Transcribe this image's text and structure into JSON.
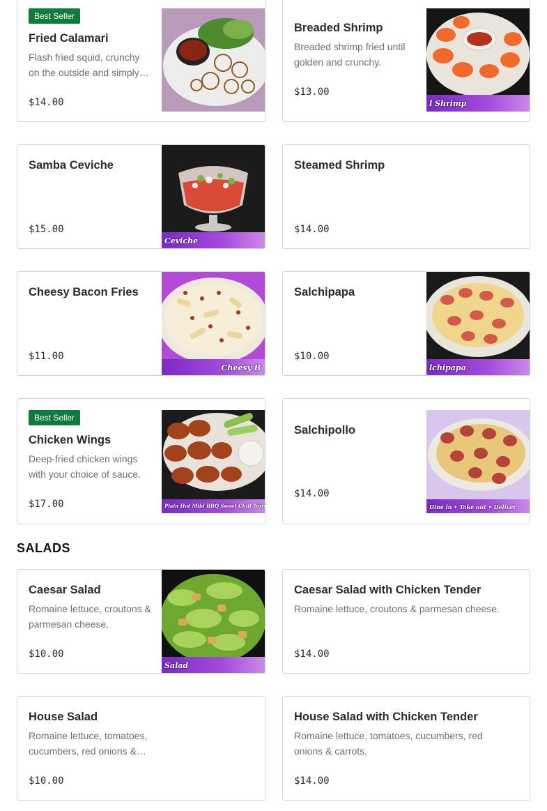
{
  "best_seller_label": "Best Seller",
  "sections": {
    "salads_title": "SALADS"
  },
  "items": [
    {
      "name": "Fried Calamari",
      "description": "Flash fried squid, crunchy on the outside and simply tender on the inside.",
      "price": "$14.00",
      "badge": "Best Seller",
      "image": "calamari-photo"
    },
    {
      "name": "Breaded Shrimp",
      "description": "Breaded shrimp fried until golden and crunchy.",
      "price": "$13.00",
      "image": "shrimp-photo",
      "image_caption": "l Shrimp"
    },
    {
      "name": "Samba Ceviche",
      "description": "",
      "price": "$15.00",
      "image": "ceviche-photo",
      "image_caption": "Ceviche"
    },
    {
      "name": "Steamed Shrimp",
      "description": "",
      "price": "$14.00"
    },
    {
      "name": "Cheesy Bacon Fries",
      "description": "",
      "price": "$11.00",
      "image": "bacon-fries-photo",
      "image_caption": "Cheesy B"
    },
    {
      "name": "Salchipapa",
      "description": "",
      "price": "$10.00",
      "image": "salchipapa-photo",
      "image_caption": "lchipapa"
    },
    {
      "name": "Chicken Wings",
      "description": "Deep-fried chicken wings with your choice of sauce.",
      "price": "$17.00",
      "badge": "Best Seller",
      "image": "wings-photo",
      "image_caption": "Plain Hot Mild BBQ Sweet Chili Teriyaki"
    },
    {
      "name": "Salchipollo",
      "description": "",
      "price": "$14.00",
      "image": "salchipollo-photo",
      "image_caption": "Dine in • Take out • Deliver"
    },
    {
      "name": "Caesar Salad",
      "description": "Romaine lettuce, croutons & parmesan cheese.",
      "price": "$10.00",
      "image": "caesar-photo",
      "image_caption": "Salad"
    },
    {
      "name": "Caesar Salad with Chicken Tender",
      "description": "Romaine lettuce, croutons & parmesan cheese.",
      "price": "$14.00"
    },
    {
      "name": "House Salad",
      "description": "Romaine lettuce, tomatoes, cucumbers, red onions & carrots.",
      "price": "$10.00"
    },
    {
      "name": "House Salad with Chicken Tender",
      "description": "Romaine lettuce, tomatoes, cucumbers, red onions & carrots.",
      "price": "$14.00"
    }
  ],
  "colors": {
    "badge_green": "#0e7a3b",
    "banner_purple": "#a54bdc",
    "border": "#d5d5d5"
  }
}
